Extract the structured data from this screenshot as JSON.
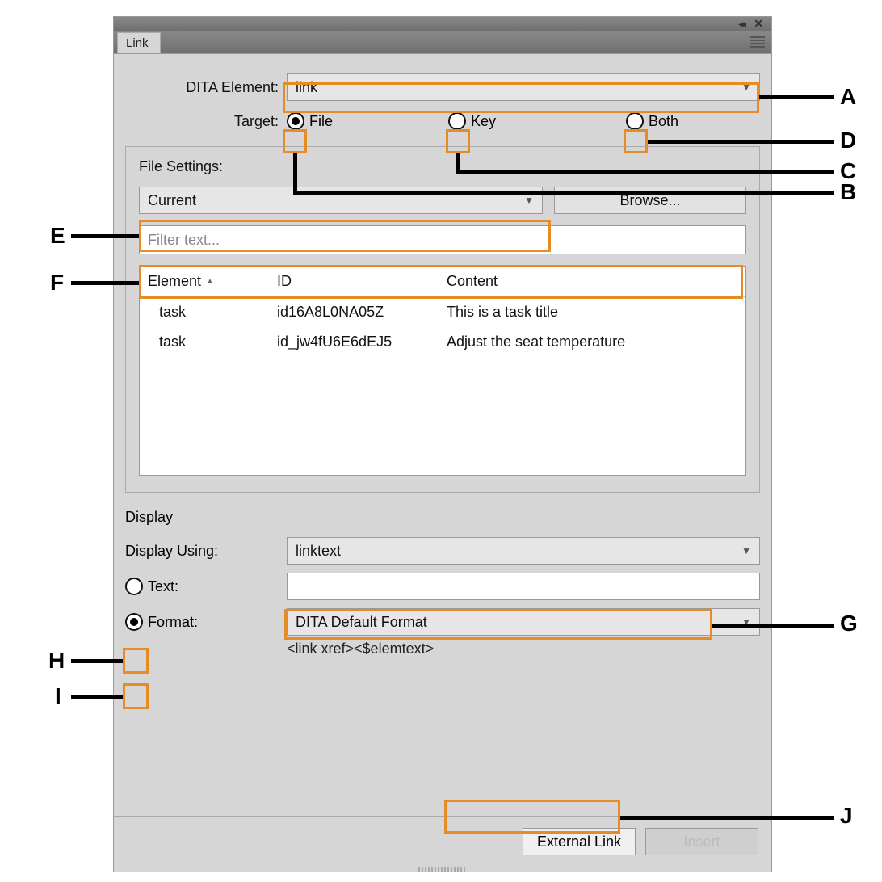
{
  "panel": {
    "tab_label": "Link"
  },
  "labels": {
    "dita_element": "DITA Element:",
    "target": "Target:",
    "file_settings": "File Settings:",
    "display": "Display",
    "display_using": "Display Using:",
    "text": "Text:",
    "format": "Format:"
  },
  "dita_element": {
    "value": "link"
  },
  "target": {
    "options": [
      "File",
      "Key",
      "Both"
    ],
    "selected": "File"
  },
  "file_settings": {
    "source_select": "Current",
    "browse_label": "Browse...",
    "filter_placeholder": "Filter text...",
    "columns": [
      "Element",
      "ID",
      "Content"
    ],
    "rows": [
      {
        "element": "task",
        "id": "id16A8L0NA05Z",
        "content": "This is a task title"
      },
      {
        "element": "task",
        "id": "id_jw4fU6E6dEJ5",
        "content": "Adjust the seat temperature"
      }
    ]
  },
  "display_using": {
    "value": "linktext"
  },
  "display_text": {
    "value": ""
  },
  "display_format": {
    "value": "DITA Default Format",
    "helper": "<link xref><$elemtext>",
    "selected": "Format"
  },
  "buttons": {
    "external_link": "External Link",
    "insert": "Insert"
  },
  "annotations": {
    "A": "A",
    "B": "B",
    "C": "C",
    "D": "D",
    "E": "E",
    "F": "F",
    "G": "G",
    "H": "H",
    "I": "I",
    "J": "J"
  }
}
